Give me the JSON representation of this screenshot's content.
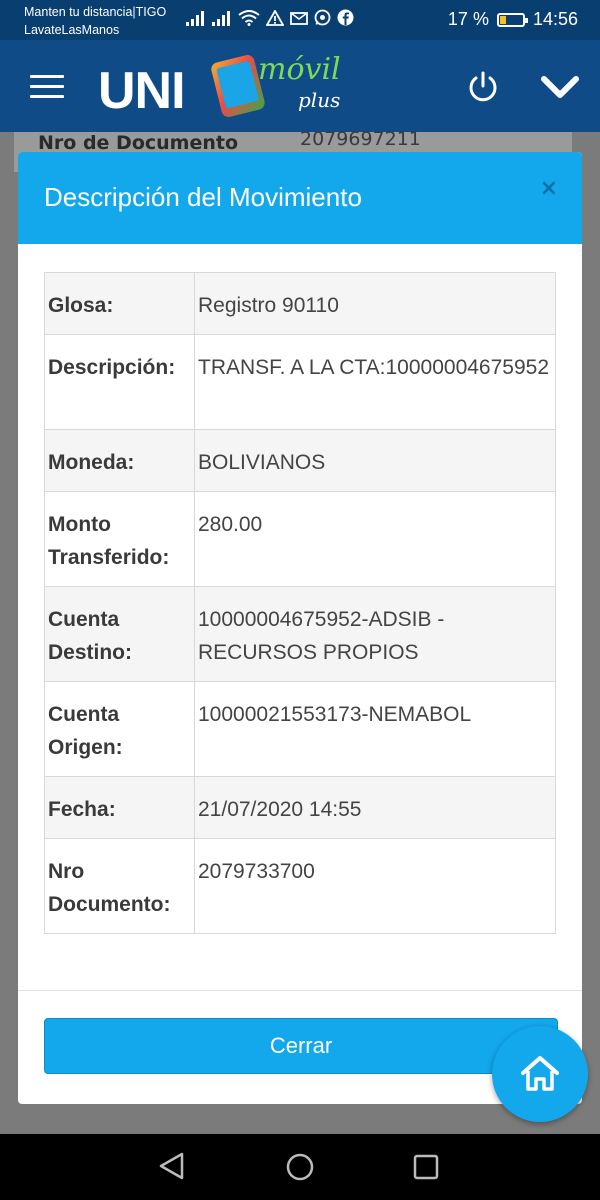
{
  "status_bar": {
    "carrier_line1": "Manten tu distancia|TIGO",
    "carrier_line2": "LavateLasManos",
    "battery_text": "17 %",
    "time": "14:56",
    "battery_level_fraction": 0.17
  },
  "header": {
    "logo": {
      "main": "UNI",
      "script": "móvil",
      "sub": "plus"
    },
    "icons": [
      "menu-icon",
      "power-icon",
      "chevron-down-icon"
    ]
  },
  "background": {
    "label": "Nro de Documento",
    "value": "2079697211"
  },
  "modal": {
    "title": "Descripción del Movimiento",
    "close_symbol": "×",
    "rows": [
      {
        "label": "Glosa:",
        "value": "Registro 90110"
      },
      {
        "label": "Descripción:",
        "value": "TRANSF. A LA CTA:10000004675952"
      },
      {
        "label": "Moneda:",
        "value": "BOLIVIANOS"
      },
      {
        "label": "Monto Transferido:",
        "value": "280.00"
      },
      {
        "label": "Cuenta Destino:",
        "value": "10000004675952-ADSIB - RECURSOS PROPIOS"
      },
      {
        "label": "Cuenta Origen:",
        "value": "10000021553173-NEMABOL"
      },
      {
        "label": "Fecha:",
        "value": "21/07/2020 14:55"
      },
      {
        "label": "Nro Documento:",
        "value": "2079733700"
      }
    ],
    "close_button": "Cerrar"
  },
  "colors": {
    "header_blue": "#0f4c87",
    "accent_blue": "#13a7ec"
  }
}
